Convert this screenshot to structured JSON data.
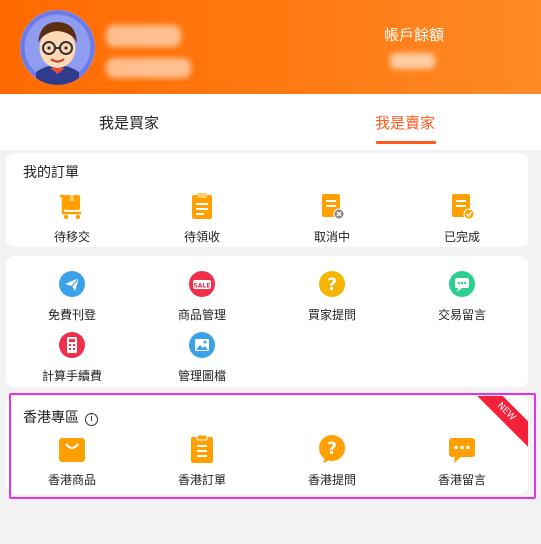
{
  "header": {
    "balance_label": "帳戶餘額"
  },
  "tabs": [
    {
      "label": "我是買家"
    },
    {
      "label": "我是賣家"
    }
  ],
  "orders": {
    "title": "我的訂單",
    "items": [
      {
        "label": "待移交",
        "icon": "package-cart-icon"
      },
      {
        "label": "待領收",
        "icon": "clipboard-icon"
      },
      {
        "label": "取消中",
        "icon": "document-cancel-icon"
      },
      {
        "label": "已完成",
        "icon": "document-check-icon"
      }
    ]
  },
  "tools": {
    "items": [
      {
        "label": "免費刊登",
        "icon": "paper-plane-icon"
      },
      {
        "label": "商品管理",
        "icon": "sale-tag-icon"
      },
      {
        "label": "買家提問",
        "icon": "question-icon"
      },
      {
        "label": "交易留言",
        "icon": "chat-bubble-icon"
      },
      {
        "label": "計算手續費",
        "icon": "calculator-icon"
      },
      {
        "label": "管理圖檔",
        "icon": "image-icon"
      }
    ]
  },
  "hk": {
    "title": "香港專區",
    "badge": "NEW",
    "items": [
      {
        "label": "香港商品",
        "icon": "shopping-bag-icon"
      },
      {
        "label": "香港訂單",
        "icon": "clipboard-list-icon"
      },
      {
        "label": "香港提問",
        "icon": "question-bubble-icon"
      },
      {
        "label": "香港留言",
        "icon": "chat-dots-icon"
      }
    ]
  },
  "colors": {
    "header": "#ff6a00",
    "accent": "#ff5a1f",
    "icon_orange": "#ffa000",
    "highlight_outline": "#e233e8",
    "badge": "#f5213a"
  }
}
